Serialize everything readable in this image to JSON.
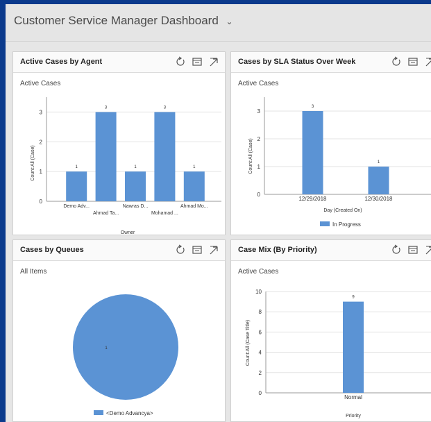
{
  "dashboard": {
    "title": "Customer Service Manager Dashboard",
    "chevron_icon": "chevron-down-icon"
  },
  "colors": {
    "bar": "#5b93d4",
    "background": "#0b3a8c",
    "panel_header": "#fafafa"
  },
  "panels": [
    {
      "title": "Active Cases by Agent",
      "view": "Active Cases",
      "xlabel": "Owner",
      "ylabel": "Count:All (Case)"
    },
    {
      "title": "Cases by SLA Status Over Week",
      "view": "Active Cases",
      "xlabel": "Day (Created On)",
      "ylabel": "Count:All (Case)",
      "legend": "In Progress"
    },
    {
      "title": "Cases by Queues",
      "view": "All Items",
      "legend": "<Demo Advancya>"
    },
    {
      "title": "Case Mix (By Priority)",
      "view": "Active Cases",
      "xlabel": "Priority",
      "ylabel": "Count:All (Case Title)"
    }
  ],
  "chart_data": [
    {
      "type": "bar",
      "title": "",
      "xlabel": "Owner",
      "ylabel": "Count:All (Case)",
      "categories": [
        "Demo Adv...",
        "Ahmad Ta...",
        "Nawras D...",
        "Mohamad ...",
        "Ahmad Mo..."
      ],
      "values": [
        1,
        3,
        1,
        3,
        1
      ],
      "yticks": [
        0,
        1,
        2,
        3
      ],
      "ylim": [
        0,
        3.5
      ]
    },
    {
      "type": "bar",
      "xlabel": "Day (Created On)",
      "ylabel": "Count:All (Case)",
      "categories": [
        "12/29/2018",
        "12/30/2018"
      ],
      "series": [
        {
          "name": "In Progress",
          "values": [
            3,
            1
          ]
        }
      ],
      "yticks": [
        0,
        1,
        2,
        3
      ],
      "ylim": [
        0,
        3.5
      ]
    },
    {
      "type": "pie",
      "categories": [
        "<Demo Advancya>"
      ],
      "values": [
        1
      ]
    },
    {
      "type": "bar",
      "xlabel": "Priority",
      "ylabel": "Count:All (Case Title)",
      "categories": [
        "Normal"
      ],
      "values": [
        9
      ],
      "yticks": [
        0,
        2,
        4,
        6,
        8,
        10
      ],
      "ylim": [
        0,
        10
      ]
    }
  ]
}
